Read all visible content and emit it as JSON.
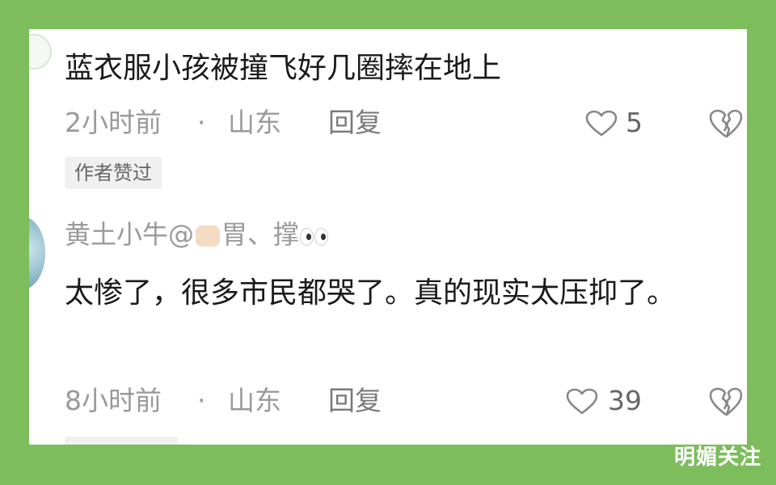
{
  "comment_1": {
    "text": "蓝衣服小孩被撞飞好几圈摔在地上",
    "time": "2小时前",
    "separator": "·",
    "location": "山东",
    "reply_label": "回复",
    "like_count": "5",
    "author_tag": "作者赞过"
  },
  "comment_2": {
    "username_prefix": "黄土小牛@",
    "username_middle": "胃",
    "username_suffix": "、撑",
    "text": "太惨了，很多市民都哭了。真的现实太压抑了。",
    "time": "8小时前",
    "separator": "·",
    "location": "山东",
    "reply_label": "回复",
    "like_count": "39"
  },
  "watermark": "明媚关注",
  "colors": {
    "background": "#7dbd5c",
    "card": "#ffffff",
    "text": "#1a1a1a",
    "meta": "#9a9a9a"
  },
  "icons": {
    "like": "heart-outline-icon",
    "dislike": "broken-heart-icon"
  }
}
